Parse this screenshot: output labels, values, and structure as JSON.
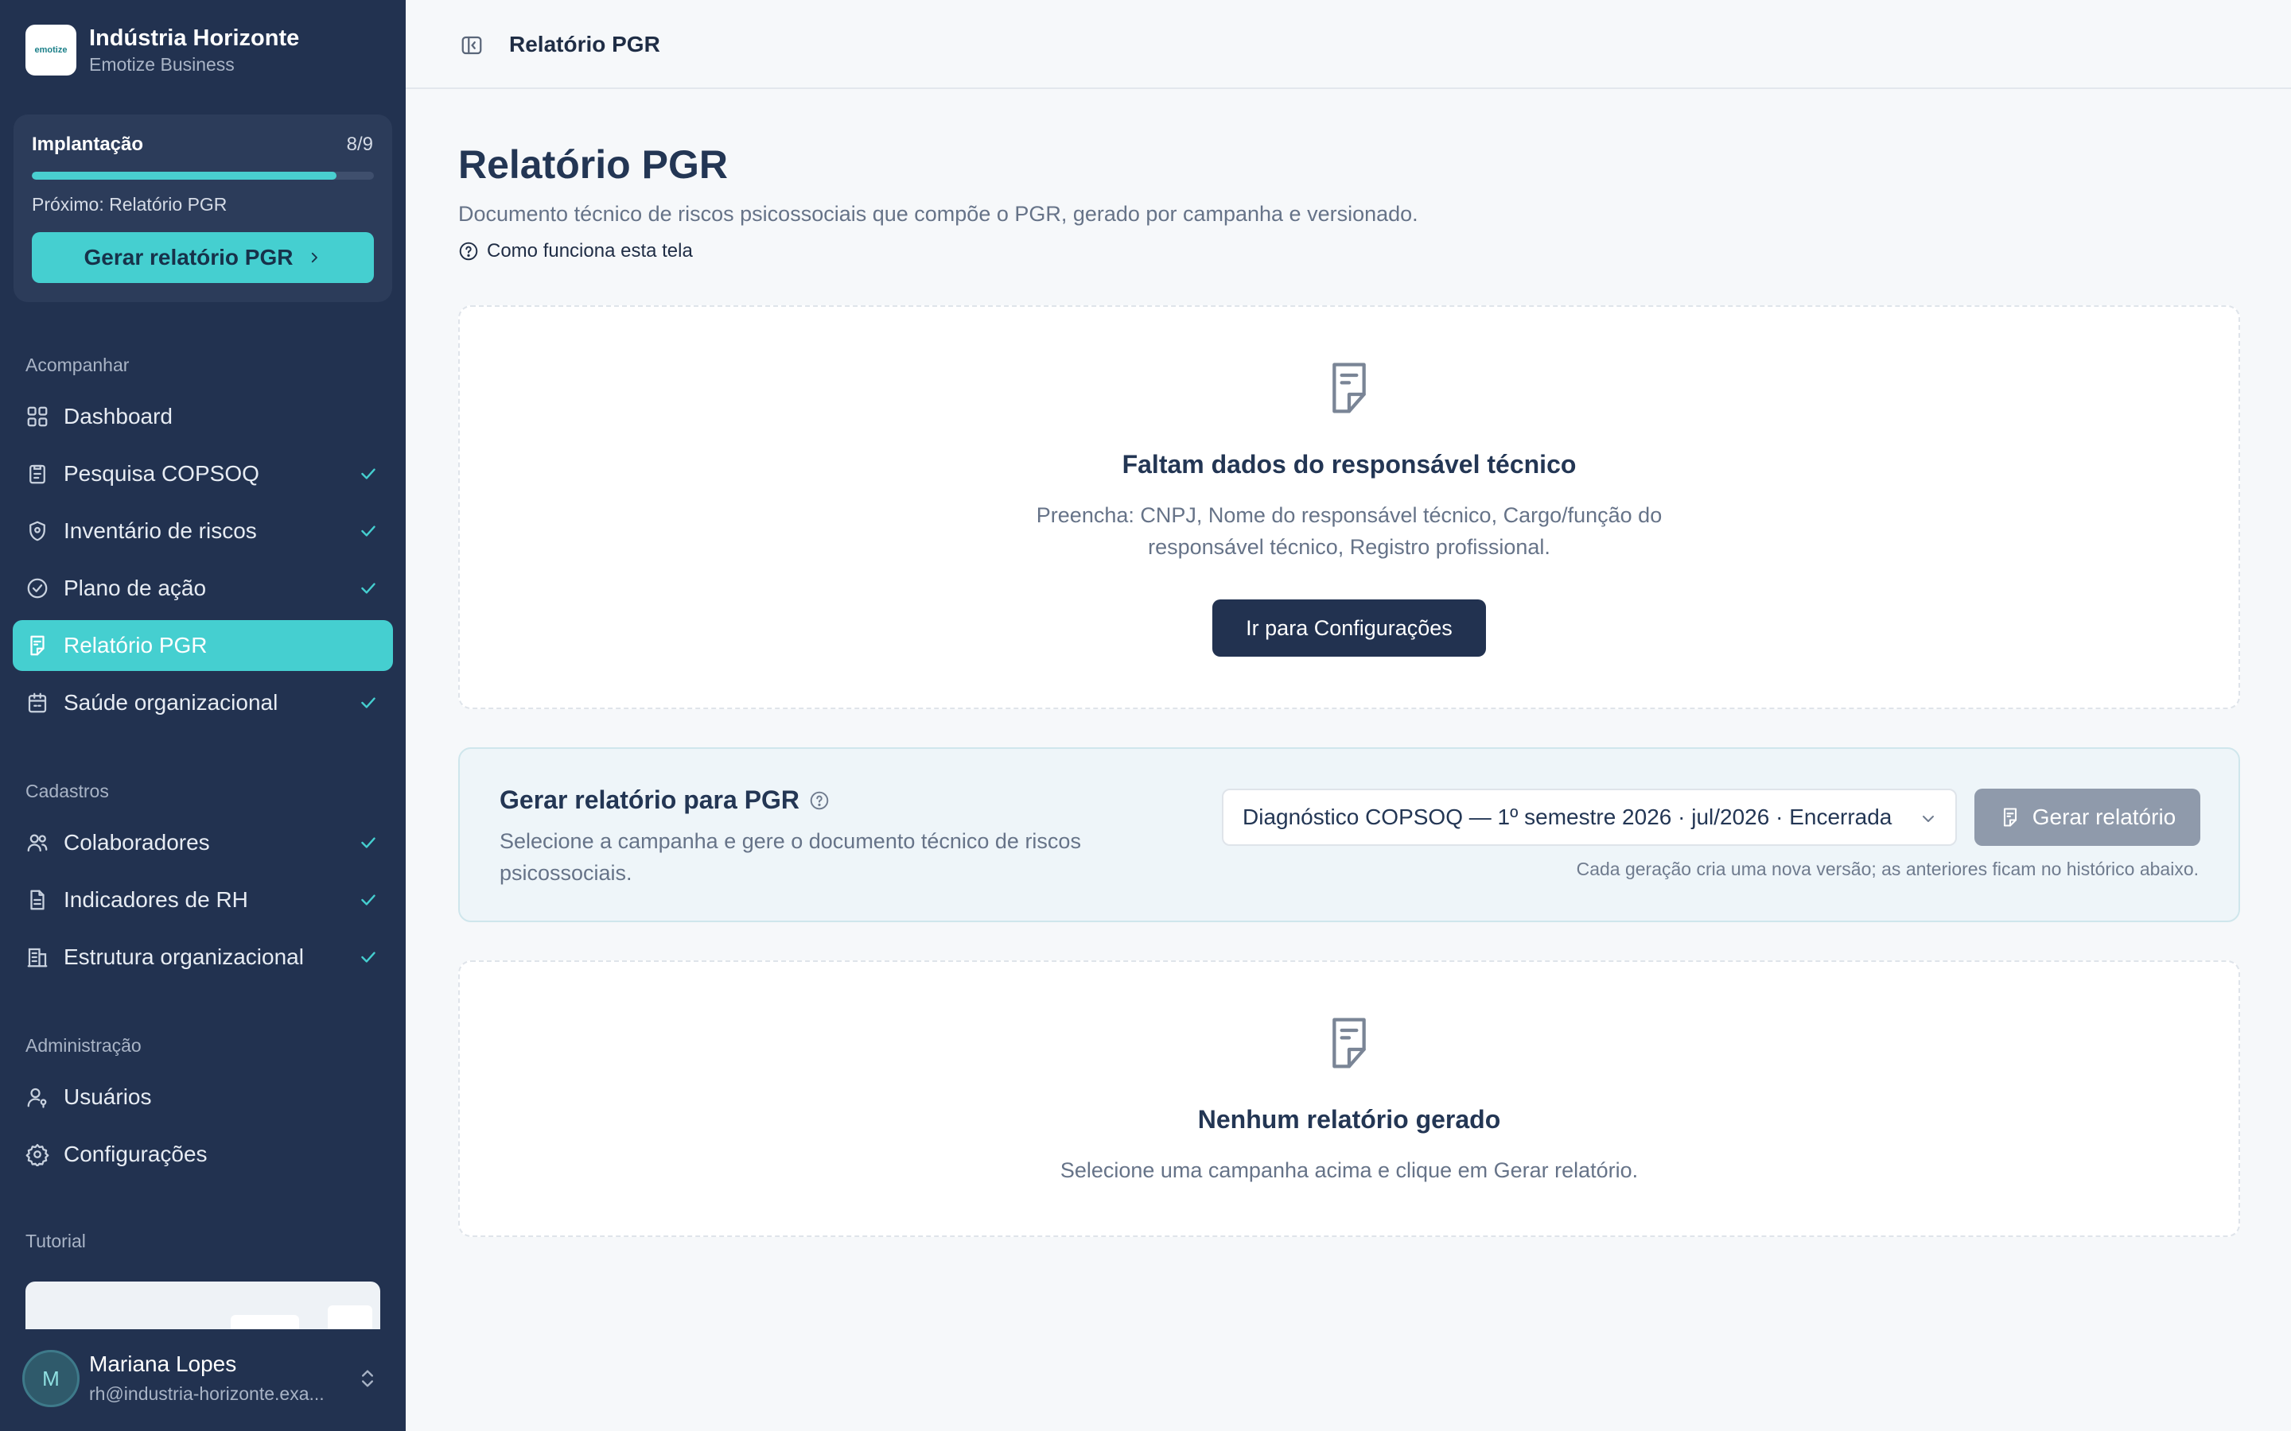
{
  "org": {
    "logo_text": "emotize",
    "name": "Indústria Horizonte",
    "subtitle": "Emotize Business"
  },
  "setup": {
    "title": "Implantação",
    "count": "8/9",
    "progress_fraction": 0.89,
    "next": "Próximo: Relatório PGR",
    "button_label": "Gerar relatório PGR"
  },
  "sections": {
    "acompanhar": "Acompanhar",
    "cadastros": "Cadastros",
    "administracao": "Administração",
    "tutorial": "Tutorial"
  },
  "nav": {
    "acompanhar": [
      {
        "label": "Dashboard",
        "icon": "grid-icon",
        "done": false,
        "active": false
      },
      {
        "label": "Pesquisa COPSOQ",
        "icon": "clipboard-icon",
        "done": true,
        "active": false
      },
      {
        "label": "Inventário de riscos",
        "icon": "shield-icon",
        "done": true,
        "active": false
      },
      {
        "label": "Plano de ação",
        "icon": "check-circle-icon",
        "done": true,
        "active": false
      },
      {
        "label": "Relatório PGR",
        "icon": "document-icon",
        "done": false,
        "active": true
      },
      {
        "label": "Saúde organizacional",
        "icon": "calendar-icon",
        "done": true,
        "active": false
      }
    ],
    "cadastros": [
      {
        "label": "Colaboradores",
        "icon": "users-icon",
        "done": true
      },
      {
        "label": "Indicadores de RH",
        "icon": "file-icon",
        "done": true
      },
      {
        "label": "Estrutura organizacional",
        "icon": "building-icon",
        "done": true
      }
    ],
    "administracao": [
      {
        "label": "Usuários",
        "icon": "user-key-icon"
      },
      {
        "label": "Configurações",
        "icon": "gear-icon"
      }
    ]
  },
  "user": {
    "initial": "M",
    "name": "Mariana Lopes",
    "email": "rh@industria-horizonte.exa..."
  },
  "topbar": {
    "title": "Relatório PGR"
  },
  "page": {
    "title": "Relatório PGR",
    "subtitle": "Documento técnico de riscos psicossociais que compõe o PGR, gerado por campanha e versionado.",
    "help_link": "Como funciona esta tela"
  },
  "missing_card": {
    "title": "Faltam dados do responsável técnico",
    "text": "Preencha: CNPJ, Nome do responsável técnico, Cargo/função do responsável técnico, Registro profissional.",
    "button": "Ir para Configurações"
  },
  "generate_card": {
    "title": "Gerar relatório para PGR",
    "subtitle": "Selecione a campanha e gere o documento técnico de riscos psicossociais.",
    "select_value": "Diagnóstico COPSOQ — 1º semestre 2026 · jul/2026 · Encerrada",
    "button": "Gerar relatório",
    "note": "Cada geração cria uma nova versão; as anteriores ficam no histórico abaixo."
  },
  "empty_card": {
    "title": "Nenhum relatório gerado",
    "text": "Selecione uma campanha acima e clique em Gerar relatório."
  },
  "colors": {
    "sidebar": "#223250",
    "accent": "#45cfd0",
    "primary_button": "#223250",
    "disabled_button": "#8f9aab"
  }
}
